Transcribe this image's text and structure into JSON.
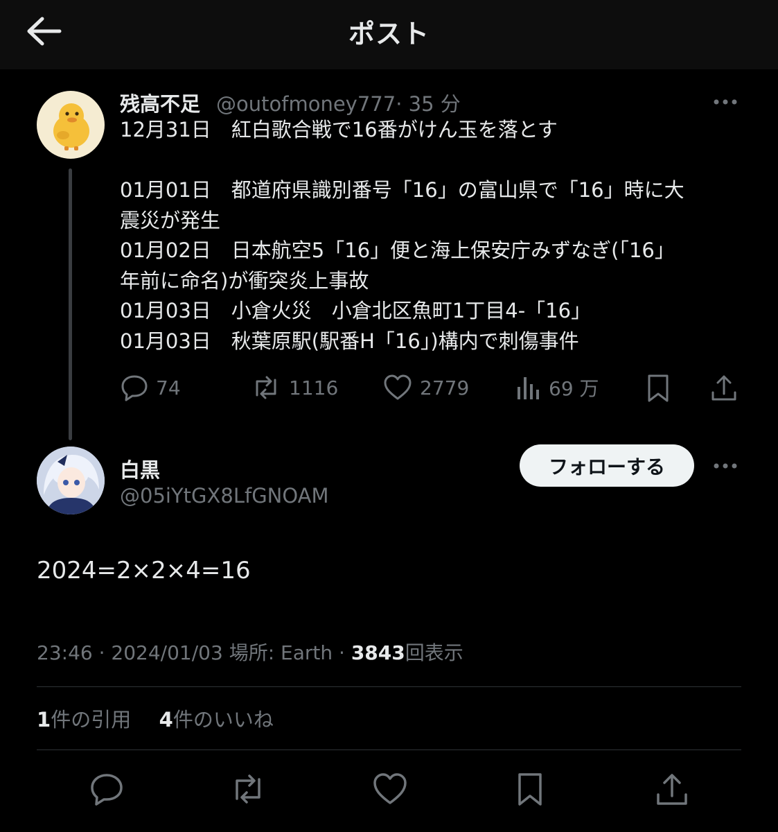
{
  "header": {
    "title": "ポスト",
    "back_icon": "arrow-left-icon"
  },
  "parent_post": {
    "author_name": "残高不足",
    "handle": "@outofmoney777",
    "time": "· 35 分",
    "avatar": "duck-avatar",
    "lines": [
      "12月31日　紅白歌合戦で16番がけん玉を落とす",
      "",
      "01月01日　都道府県識別番号「16」の富山県で「16」時に大",
      "震災が発生",
      "01月02日　日本航空5「16」便と海上保安庁みずなぎ(「16」",
      "年前に命名)が衝突炎上事故",
      "01月03日　小倉火災　小倉北区魚町1丁目4-「16」",
      "01月03日　秋葉原駅(駅番H「16」)構内で刺傷事件"
    ],
    "actions": {
      "reply_count": "74",
      "repost_count": "1116",
      "like_count": "2779",
      "view_count": "69 万"
    }
  },
  "post": {
    "author_name": "白黒",
    "handle": "@05iYtGX8LfGNOAM",
    "follow_label": "フォローする",
    "text": "2024=2×2×4=16",
    "time": "23:46",
    "date": "2024/01/03",
    "location_label": "場所: Earth",
    "views_number": "3843",
    "views_label": "回表示",
    "quote_count": "1",
    "quote_label": "件の引用",
    "likes_count": "4",
    "likes_label": "件のいいね"
  },
  "colors": {
    "background": "#000000",
    "header": "#0d0d0d",
    "text": "#e7e9ea",
    "muted": "#71767b",
    "divider": "#2f3336",
    "follow_bg": "#eff3f4"
  }
}
